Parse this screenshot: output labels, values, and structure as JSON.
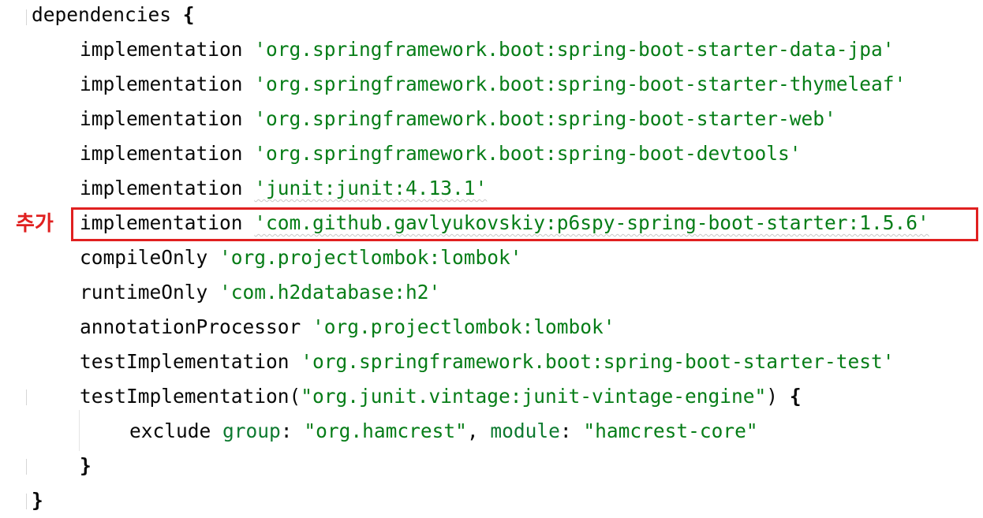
{
  "code": {
    "open": {
      "keyword": "dependencies",
      "brace": "{"
    },
    "lines": [
      {
        "config": "implementation",
        "artifact": "'org.springframework.boot:spring-boot-starter-data-jpa'"
      },
      {
        "config": "implementation",
        "artifact": "'org.springframework.boot:spring-boot-starter-thymeleaf'"
      },
      {
        "config": "implementation",
        "artifact": "'org.springframework.boot:spring-boot-starter-web'"
      },
      {
        "config": "implementation",
        "artifact": "'org.springframework.boot:spring-boot-devtools'"
      },
      {
        "config": "implementation",
        "artifact": "'junit:junit:4.13.1'"
      },
      {
        "config": "implementation",
        "artifact": "'com.github.gavlyukovskiy:p6spy-spring-boot-starter:1.5.6'"
      },
      {
        "config": "compileOnly",
        "artifact": "'org.projectlombok:lombok'"
      },
      {
        "config": "runtimeOnly",
        "artifact": "'com.h2database:h2'"
      },
      {
        "config": "annotationProcessor",
        "artifact": "'org.projectlombok:lombok'"
      },
      {
        "config": "testImplementation",
        "artifact": "'org.springframework.boot:spring-boot-starter-test'"
      }
    ],
    "test_block": {
      "config": "testImplementation",
      "paren_open": "(",
      "artifact": "\"org.junit.vintage:junit-vintage-engine\"",
      "paren_close": ")",
      "brace": "{",
      "exclude_keyword": "exclude",
      "group_label": "group",
      "colon": ":",
      "group_value": "\"org.hamcrest\"",
      "comma": ",",
      "module_label": "module",
      "module_value": "\"hamcrest-core\"",
      "close_brace": "}"
    },
    "close": "}"
  },
  "annotation": {
    "label": "추가",
    "color": "#e02020"
  },
  "colors": {
    "string": "#067d17",
    "named_arg": "#0d7a30",
    "text": "#080808",
    "highlight": "#e02020"
  }
}
